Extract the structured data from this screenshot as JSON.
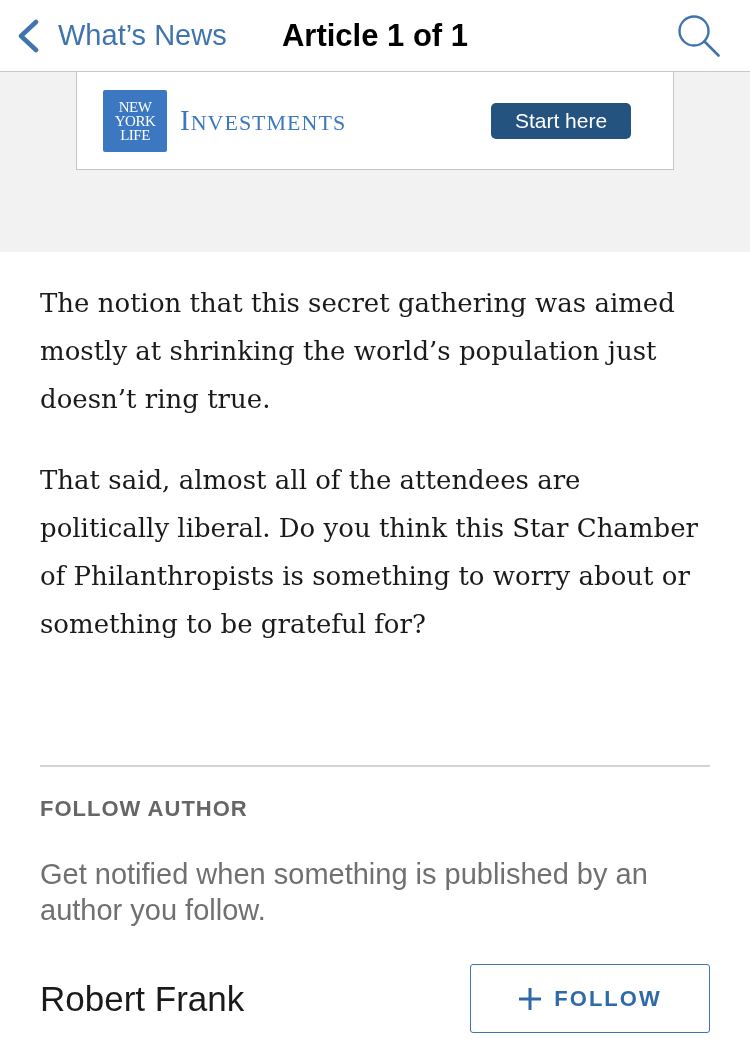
{
  "nav": {
    "back_label": "What’s News",
    "title": "Article 1 of 1"
  },
  "ad": {
    "logo_text": "NEW YORK LIFE",
    "brand": "INVESTMENTS",
    "cta": "Start here"
  },
  "article": {
    "paragraphs": [
      "The notion that this secret gathering was aimed mostly at shrinking the world’s population just doesn’t ring true.",
      "That said, almost all of the attendees are politically liberal. Do you think this Star Chamber of Philanthropists is something to worry about or something to be grateful for?"
    ]
  },
  "follow_author": {
    "heading": "FOLLOW AUTHOR",
    "description": "Get notified when something is published by an author you follow.",
    "author": "Robert Frank",
    "button": "FOLLOW"
  }
}
